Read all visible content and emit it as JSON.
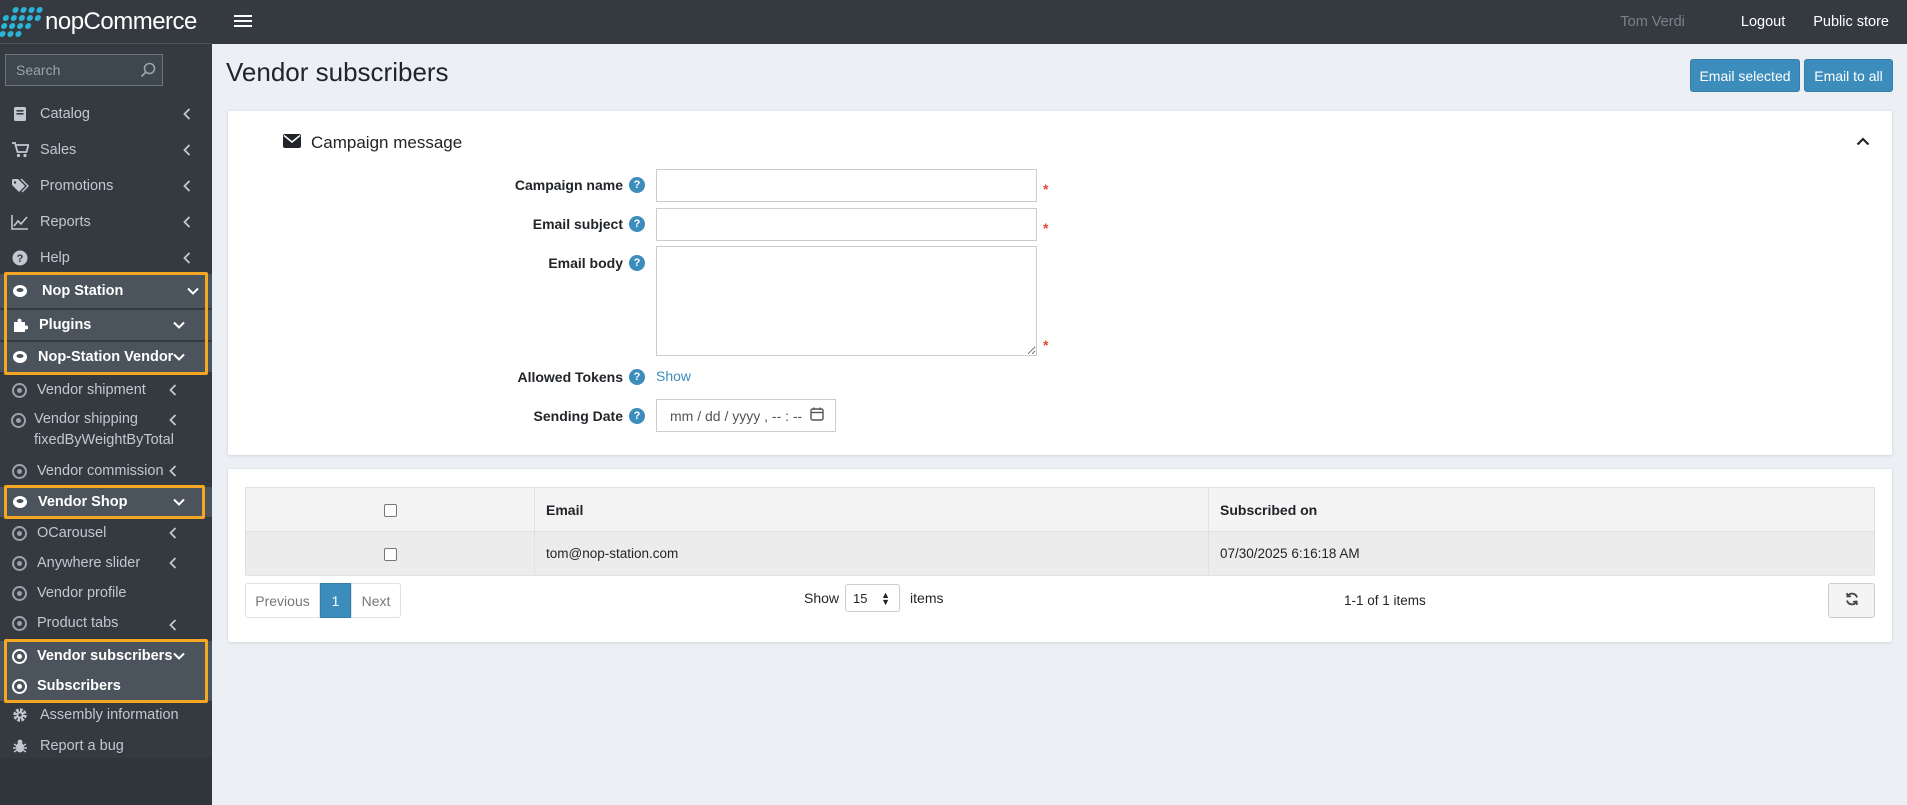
{
  "app": {
    "logo_prefix": "nop",
    "logo_suffix": "Commerce"
  },
  "search": {
    "placeholder": "Search"
  },
  "sidebar": {
    "items": [
      {
        "label": "Catalog",
        "icon": "book-icon"
      },
      {
        "label": "Sales",
        "icon": "cart-icon"
      },
      {
        "label": "Promotions",
        "icon": "tags-icon"
      },
      {
        "label": "Reports",
        "icon": "chart-line-icon"
      },
      {
        "label": "Help",
        "icon": "question-circle-icon"
      },
      {
        "label": "Nop Station",
        "icon": "cloud-icon"
      },
      {
        "label": "Plugins",
        "icon": "puzzle-icon"
      },
      {
        "label": "Nop-Station Vendor",
        "icon": "cloud-icon"
      },
      {
        "label": "Vendor shipment",
        "icon": "circle-icon"
      },
      {
        "label": "Vendor shipping",
        "label2": "fixedByWeightByTotal",
        "icon": "circle-icon"
      },
      {
        "label": "Vendor commission",
        "icon": "circle-icon"
      },
      {
        "label": "Vendor Shop",
        "icon": "cloud-icon"
      },
      {
        "label": "OCarousel",
        "icon": "circle-icon"
      },
      {
        "label": "Anywhere slider",
        "icon": "circle-icon"
      },
      {
        "label": "Vendor profile",
        "icon": "circle-icon"
      },
      {
        "label": "Product tabs",
        "icon": "circle-icon"
      },
      {
        "label": "Vendor subscribers",
        "icon": "circle-icon"
      },
      {
        "label": "Subscribers",
        "icon": "circle-icon"
      },
      {
        "label": "Assembly information",
        "icon": "gear-icon"
      },
      {
        "label": "Report a bug",
        "icon": "bug-icon"
      }
    ]
  },
  "topbar": {
    "user": "Tom Verdi",
    "logout": "Logout",
    "public_store": "Public store"
  },
  "page": {
    "title": "Vendor subscribers"
  },
  "actions": {
    "email_selected": "Email selected",
    "email_to_all": "Email to all"
  },
  "campaign": {
    "header": "Campaign message",
    "campaign_name_label": "Campaign name",
    "campaign_name_value": "",
    "email_subject_label": "Email subject",
    "email_subject_value": "",
    "email_body_label": "Email body",
    "email_body_value": "",
    "allowed_tokens_label": "Allowed Tokens",
    "show_link": "Show",
    "sending_date_label": "Sending Date",
    "sending_date_placeholder": "mm / dd / yyyy ,  -- : --",
    "required_mark": "*",
    "help_mark": "?"
  },
  "table": {
    "columns": [
      "Email",
      "Subscribed on"
    ],
    "rows": [
      {
        "email": "tom@nop-station.com",
        "subscribed_on": "07/30/2025 6:16:18 AM"
      }
    ]
  },
  "pager": {
    "previous": "Previous",
    "page": "1",
    "next": "Next",
    "show": "Show",
    "page_size": "15",
    "items": "items",
    "info": "1-1 of 1 items"
  },
  "colors": {
    "accent": "#3c8dbc",
    "sidebar": "#343a40",
    "highlight_box": "#f5a623",
    "required": "#dd4b39"
  }
}
